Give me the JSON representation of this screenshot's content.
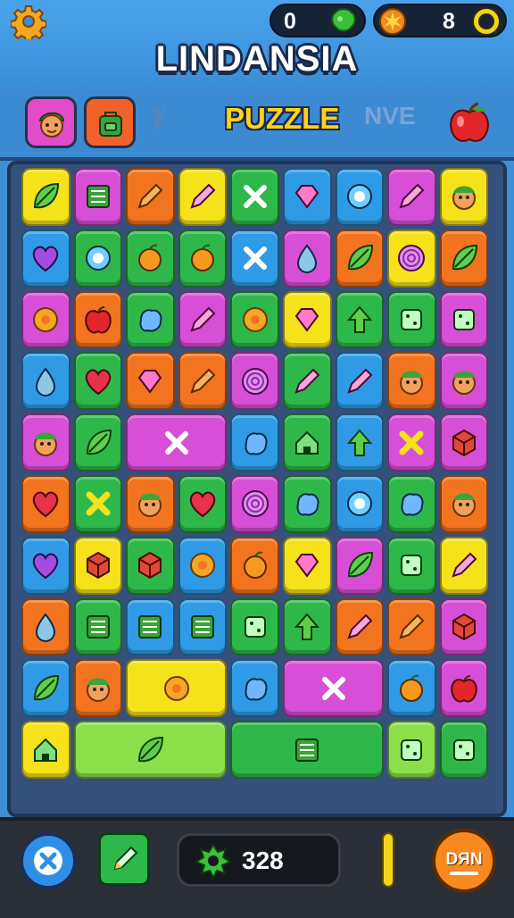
{
  "header": {
    "title": "LINDANSIA",
    "left_counter": "0",
    "right_counter": "8",
    "settings_icon": "gear-icon",
    "left_counter_icon": "green-gem-icon",
    "right_counter_icon": "starburst-coin-icon",
    "ring_icon": "ring-icon"
  },
  "tabs": {
    "items": [
      {
        "label": "",
        "icon": "elf-face-icon"
      },
      {
        "label": "",
        "icon": "green-backpack-icon"
      },
      {
        "label": "ⱦ",
        "icon": ""
      },
      {
        "label": "PUZZLE",
        "icon": ""
      },
      {
        "label": "NVE",
        "icon": ""
      },
      {
        "label": "",
        "icon": "apple-icon"
      }
    ]
  },
  "bottom": {
    "score": "328",
    "score_icon": "green-splat-icon",
    "close_icon": "close-icon",
    "edit_icon": "pencil-icon",
    "action_label": "DЯN",
    "colors": {
      "accent": "#f7891f",
      "blue": "#2f8fe6",
      "green": "#2fb84a"
    }
  }
}
